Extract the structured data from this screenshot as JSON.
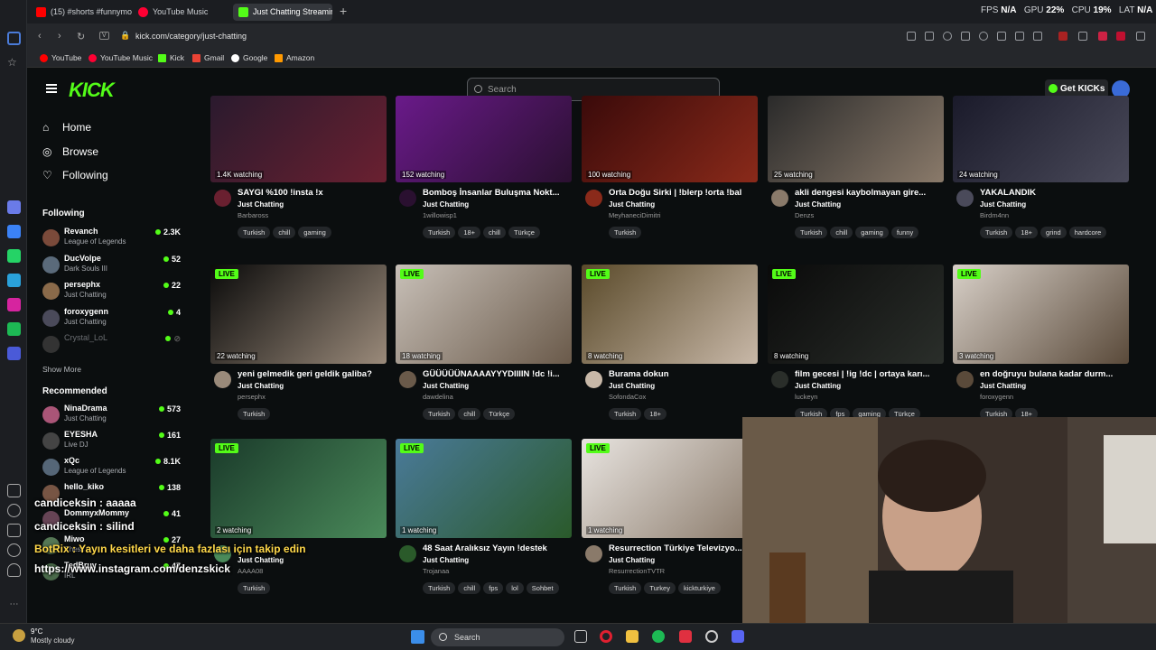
{
  "browser": {
    "tabs": [
      {
        "label": "(15) #shorts #funnymoms",
        "color": "#ff0000"
      },
      {
        "label": "YouTube Music",
        "color": "#ff0033"
      },
      {
        "label": "Just Chatting Streaming -",
        "color": "#53fc18"
      }
    ],
    "new_tab": "+",
    "url": "kick.com/category/just-chatting",
    "url_badge": "V",
    "stats": {
      "fps_label": "FPS",
      "fps": "N/A",
      "gpu_label": "GPU",
      "gpu": "22%",
      "cpu_label": "CPU",
      "cpu": "19%",
      "lat_label": "LAT",
      "lat": "N/A"
    },
    "bookmarks": [
      {
        "label": "YouTube",
        "color": "#ff0000"
      },
      {
        "label": "YouTube Music",
        "color": "#ff0033"
      },
      {
        "label": "Kick",
        "color": "#53fc18"
      },
      {
        "label": "Gmail",
        "color": "#ea4335"
      },
      {
        "label": "Google",
        "color": "#4285f4"
      },
      {
        "label": "Amazon",
        "color": "#ff9900"
      }
    ]
  },
  "header": {
    "logo": "KICK",
    "search_placeholder": "Search",
    "get_kicks": "Get KICKs"
  },
  "sidebar": {
    "nav": [
      {
        "label": "Home",
        "icon": "home-icon",
        "glyph": "⌂"
      },
      {
        "label": "Browse",
        "icon": "compass-icon",
        "glyph": "◎"
      },
      {
        "label": "Following",
        "icon": "heart-icon",
        "glyph": "♡"
      }
    ],
    "following_title": "Following",
    "following": [
      {
        "name": "Revanch",
        "category": "League of Legends",
        "viewers": "2.3K",
        "color": "#7a4a3a"
      },
      {
        "name": "DucVolpe",
        "category": "Dark Souls III",
        "viewers": "52",
        "color": "#5a6a7a"
      },
      {
        "name": "persephx",
        "category": "Just Chatting",
        "viewers": "22",
        "color": "#8a6a4a"
      },
      {
        "name": "foroxygenn",
        "category": "Just Chatting",
        "viewers": "4",
        "color": "#4a4a5a"
      },
      {
        "name": "Crystal_LoL",
        "category": "",
        "viewers": "",
        "color": "#333"
      }
    ],
    "show_more": "Show More",
    "recommended_title": "Recommended",
    "recommended": [
      {
        "name": "NinaDrama",
        "category": "Just Chatting",
        "viewers": "573",
        "color": "#aa5577"
      },
      {
        "name": "EYESHA",
        "category": "Live DJ",
        "viewers": "161",
        "color": "#444"
      },
      {
        "name": "xQc",
        "category": "League of Legends",
        "viewers": "8.1K",
        "color": "#556677"
      },
      {
        "name": "hello_kiko",
        "category": "",
        "viewers": "138",
        "color": "#775544"
      },
      {
        "name": "DommyxMommy",
        "category": "",
        "viewers": "41",
        "color": "#664455"
      },
      {
        "name": "Miwo",
        "category": "Chess",
        "viewers": "27",
        "color": "#557755"
      },
      {
        "name": "TedBruv",
        "category": "IRL",
        "viewers": "47",
        "color": "#4a6a4a"
      }
    ]
  },
  "chat_overlay": [
    "candiceksin : aaaaa",
    "candiceksin : silind",
    "BotRix : Yayın kesitleri ve daha fazlası için takip edin",
    "https://www.instagram.com/denzskick"
  ],
  "streams": [
    {
      "title": "SAYGI %100 !insta !x",
      "category": "Just Chatting",
      "streamer": "Barbaross",
      "watching": "1.4K watching",
      "tags": [
        "Turkish",
        "chill",
        "gaming"
      ],
      "live": false,
      "colors": [
        "#2a1a2e",
        "#6a2030"
      ]
    },
    {
      "title": "Bomboş İnsanlar Buluşma Nokt...",
      "category": "Just Chatting",
      "streamer": "1willowisp1",
      "watching": "152 watching",
      "tags": [
        "Turkish",
        "18+",
        "chill",
        "Türkçe"
      ],
      "live": false,
      "colors": [
        "#6a1a8a",
        "#2a1030"
      ]
    },
    {
      "title": "Orta Doğu Sirki | !blerp !orta !bal",
      "category": "Just Chatting",
      "streamer": "MeyhaneciDimitri",
      "watching": "100 watching",
      "tags": [
        "Turkish"
      ],
      "live": false,
      "colors": [
        "#3a0a0a",
        "#8a2a1a"
      ]
    },
    {
      "title": "akli dengesi kaybolmayan gire...",
      "category": "Just Chatting",
      "streamer": "Denzs",
      "watching": "25 watching",
      "tags": [
        "Turkish",
        "chill",
        "gaming",
        "funny"
      ],
      "live": false,
      "colors": [
        "#2a2a2a",
        "#8a7a6a"
      ]
    },
    {
      "title": "YAKALANDIK",
      "category": "Just Chatting",
      "streamer": "Birdm4nn",
      "watching": "24 watching",
      "tags": [
        "Turkish",
        "18+",
        "grind",
        "hardcore"
      ],
      "live": false,
      "colors": [
        "#1a1a2a",
        "#4a4a5a"
      ]
    },
    {
      "title": "yeni gelmedik geri geldik galiba?",
      "category": "Just Chatting",
      "streamer": "persephx",
      "watching": "22 watching",
      "tags": [
        "Turkish"
      ],
      "live": true,
      "colors": [
        "#0a0a0a",
        "#9a8a7a"
      ]
    },
    {
      "title": "GÜÜÜÜÜNAAAAYYYDIIIIN !dc !i...",
      "category": "Just Chatting",
      "streamer": "dawdelina",
      "watching": "18 watching",
      "tags": [
        "Turkish",
        "chill",
        "Türkçe"
      ],
      "live": true,
      "colors": [
        "#c8c0b8",
        "#6a5a4a"
      ]
    },
    {
      "title": "Burama dokun",
      "category": "Just Chatting",
      "streamer": "SofondaCox",
      "watching": "8 watching",
      "tags": [
        "Turkish",
        "18+"
      ],
      "live": true,
      "colors": [
        "#5a4a2a",
        "#c8b8a8"
      ]
    },
    {
      "title": "film gecesi | !ig !dc | ortaya karı...",
      "category": "Just Chatting",
      "streamer": "luckeyn",
      "watching": "8 watching",
      "tags": [
        "Turkish",
        "fps",
        "gaming",
        "Türkçe"
      ],
      "live": true,
      "colors": [
        "#0a0a0a",
        "#2a2e2a"
      ]
    },
    {
      "title": "en doğruyu bulana kadar durm...",
      "category": "Just Chatting",
      "streamer": "foroxygenn",
      "watching": "3 watching",
      "tags": [
        "Turkish",
        "18+"
      ],
      "live": true,
      "colors": [
        "#d8d0c8",
        "#5a4a3a"
      ]
    },
    {
      "title": "",
      "category": "Just Chatting",
      "streamer": "AAAA08",
      "watching": "2 watching",
      "tags": [
        "Turkish"
      ],
      "live": true,
      "colors": [
        "#1a3a2a",
        "#4a8a5a"
      ]
    },
    {
      "title": "48 Saat Aralıksız Yayın !destek",
      "category": "Just Chatting",
      "streamer": "Trojanaa",
      "watching": "1 watching",
      "tags": [
        "Turkish",
        "chill",
        "fps",
        "lol",
        "Sohbet"
      ],
      "live": true,
      "colors": [
        "#4a7a9a",
        "#2a5a2a"
      ]
    },
    {
      "title": "Resurrection Türkiye Televizyo...",
      "category": "Just Chatting",
      "streamer": "ResurrectionTVTR",
      "watching": "1 watching",
      "tags": [
        "Turkish",
        "Turkey",
        "kickturkiye"
      ],
      "live": true,
      "colors": [
        "#e8e4e0",
        "#8a7a6a"
      ]
    }
  ],
  "taskbar": {
    "temp": "9°C",
    "weather": "Mostly cloudy",
    "search": "Search"
  }
}
